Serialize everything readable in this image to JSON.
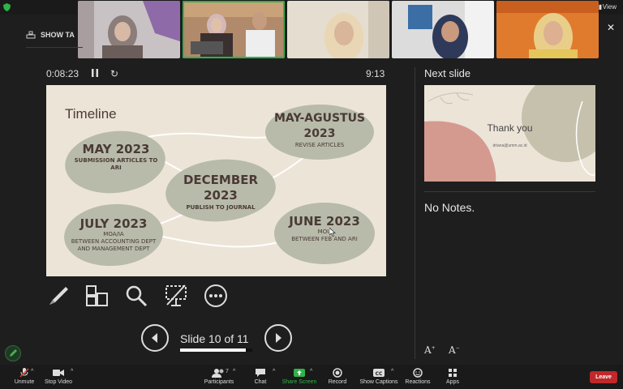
{
  "topbar": {
    "view_label": "View"
  },
  "show_task": {
    "label": "SHOW TA"
  },
  "timer": {
    "elapsed": "0:08:23",
    "clock": "9:13"
  },
  "next_panel": {
    "label": "Next slide",
    "notes": "No Notes."
  },
  "current_slide": {
    "title": "Timeline",
    "items": [
      {
        "heading": "MAY 2023",
        "detail": "SUBMISSION ARTICLES TO ARI"
      },
      {
        "heading": "DECEMBER 2023",
        "detail": "PUBLISH TO JOURNAL"
      },
      {
        "heading": "MAY-AGUSTUS 2023",
        "detail": "REVISE ARTICLES"
      },
      {
        "heading": "JULY 2023",
        "detail_lines": [
          "MOA/IA",
          "BETWEEN ACCOUNTING DEPT",
          "AND MANAGEMENT DEPT"
        ]
      },
      {
        "heading": "JUNE 2023",
        "detail_lines": [
          "MOU",
          "BETWEEN FEB AND ARI"
        ]
      }
    ]
  },
  "next_slide": {
    "title": "Thank you",
    "email": "driana@umm.ac.id"
  },
  "navigation": {
    "counter": "Slide 10 of 11",
    "progress": 0.909
  },
  "toolbar": {
    "unmute": "Unmute",
    "stop_video": "Stop Video",
    "participants": "Participants",
    "participants_count": "7",
    "chat": "Chat",
    "share_screen": "Share Screen",
    "record": "Record",
    "show_captions": "Show Captions",
    "reactions": "Reactions",
    "apps": "Apps",
    "leave": "Leave"
  },
  "colors": {
    "accent_green": "#2fb34a",
    "leave_red": "#c0282a",
    "slide_bg": "#ede4d8",
    "blob_green": "#b8bba9",
    "text_dark": "#4a3a36"
  }
}
